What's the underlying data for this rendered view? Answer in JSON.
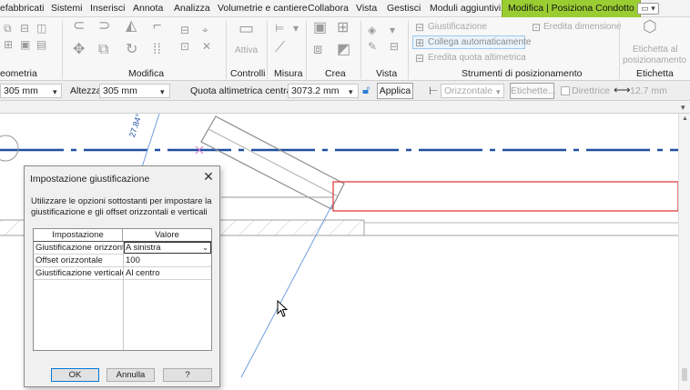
{
  "menu": {
    "tabs": [
      "efabbricati",
      "Sistemi",
      "Inserisci",
      "Annota",
      "Analizza",
      "Volumetrie e cantiere",
      "Collabora",
      "Vista",
      "Gestisci",
      "Moduli aggiuntivi"
    ],
    "active_tab": "Modifica | Posiziona Condotto",
    "extra_button": "▭ ▾"
  },
  "ribbon": {
    "panels": [
      "eometria",
      "Modifica",
      "Controlli",
      "Misura",
      "Crea",
      "Vista",
      "Strumenti di posizionamento",
      "Etichetta"
    ],
    "attiva_label": "Attiva",
    "tools": {
      "giustificazione": "Giustificazione",
      "eredita_dimensione": "Eredita dimensione",
      "collega_automaticamente": "Collega automaticamente",
      "eredita_quota": "Eredita quota altimetrica"
    },
    "etichetta_line1": "Etichetta al",
    "etichetta_line2": "posizionamento"
  },
  "options_bar": {
    "width_value": "305 mm",
    "altezza_label": "Altezza:",
    "altezza_value": "305 mm",
    "quota_label": "Quota altimetrica centrale:",
    "quota_value": "3073.2 mm",
    "applica": "Applica",
    "orientation_value": "Orizzontale",
    "etichette_btn": "Etichette...",
    "direttrice_label": "Direttrice",
    "distance_value": "12.7 mm"
  },
  "canvas": {
    "angle_label": "27.84°"
  },
  "dialog": {
    "title": "Impostazione giustificazione",
    "description": "Utilizzare le opzioni sottostanti per impostare la giustificazione e gli offset orizzontali e verticali",
    "columns": [
      "Impostazione",
      "Valore"
    ],
    "rows": [
      {
        "setting": "Giustificazione orizzontale",
        "value": "A sinistra"
      },
      {
        "setting": "Offset orizzontale",
        "value": "100"
      },
      {
        "setting": "Giustificazione verticale",
        "value": "Al centro"
      }
    ],
    "buttons": {
      "ok": "OK",
      "cancel": "Annulla",
      "help": "?"
    }
  },
  "colors": {
    "active_tab": "#9acd32",
    "duct_blue": "#1f4fa0",
    "selection_red": "#e03030",
    "link_blue": "#6fa0e0"
  }
}
